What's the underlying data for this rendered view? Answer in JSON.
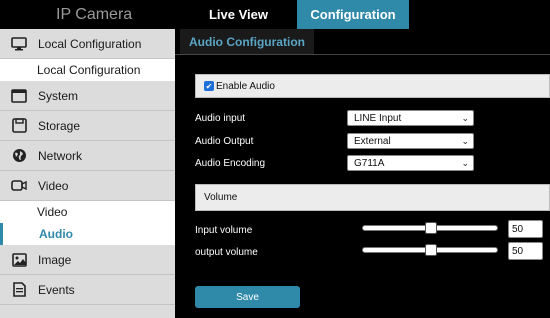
{
  "header": {
    "brand": "IP Camera",
    "tabs": [
      {
        "label": "Live View"
      },
      {
        "label": "Configuration"
      }
    ]
  },
  "sidebar": {
    "items": [
      {
        "label": "Local Configuration",
        "icon": "monitor-icon"
      },
      {
        "label": "Local Configuration"
      },
      {
        "label": "System",
        "icon": "system-icon"
      },
      {
        "label": "Storage",
        "icon": "storage-icon"
      },
      {
        "label": "Network",
        "icon": "globe-icon"
      },
      {
        "label": "Video",
        "icon": "video-icon"
      },
      {
        "label": "Video"
      },
      {
        "label": "Audio"
      },
      {
        "label": "Image",
        "icon": "image-icon"
      },
      {
        "label": "Events",
        "icon": "events-icon"
      }
    ]
  },
  "main": {
    "section_title": "Audio Configuration",
    "enable_audio_label": "Enable Audio",
    "enable_audio_checked": true,
    "audio_input": {
      "label": "Audio input",
      "value": "LINE Input"
    },
    "audio_output": {
      "label": "Audio Output",
      "value": "External"
    },
    "audio_encoding": {
      "label": "Audio Encoding",
      "value": "G711A"
    },
    "volume_title": "Volume",
    "input_volume": {
      "label": "Input volume",
      "value": "50"
    },
    "output_volume": {
      "label": "output volume",
      "value": "50"
    },
    "save_label": "Save"
  },
  "colors": {
    "accent": "#2f89a9",
    "sidebar_bg": "#dcdcdc",
    "content_bg": "#000000"
  }
}
